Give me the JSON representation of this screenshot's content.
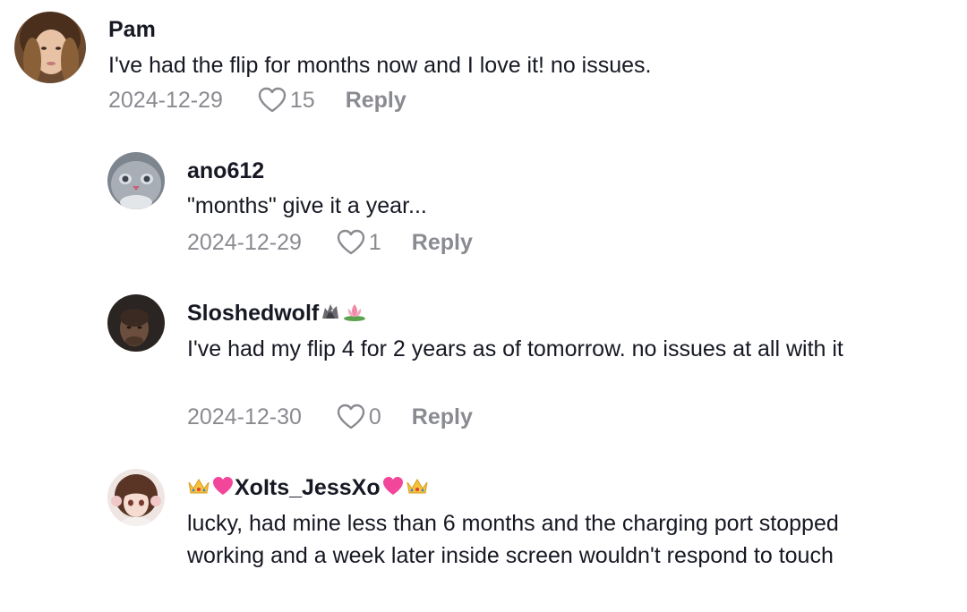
{
  "comments": [
    {
      "username": "Pam",
      "text": "I've had the flip for months now and I love it! no issues.",
      "date": "2024-12-29",
      "likes": "15",
      "reply_label": "Reply"
    },
    {
      "username": "ano612",
      "text": "\"months\" give it a year...",
      "date": "2024-12-29",
      "likes": "1",
      "reply_label": "Reply"
    },
    {
      "username": "Sloshedwolf",
      "username_emojis": [
        "wolf-emoji",
        "lotus-emoji"
      ],
      "text": "I've had my flip 4 for 2 years as of tomorrow. no issues at all with it",
      "date": "2024-12-30",
      "likes": "0",
      "reply_label": "Reply"
    },
    {
      "username": "XoIts_JessXo",
      "username_emojis": [
        "crown-emoji",
        "pink-heart-emoji",
        "pink-heart-emoji",
        "crown-emoji"
      ],
      "text": "lucky, had mine less than 6 months and the charging port stopped working and a week later inside screen wouldn't respond to touch"
    }
  ],
  "colors": {
    "text_primary": "#161823",
    "text_secondary": "#8a8b91",
    "background": "#ffffff"
  }
}
